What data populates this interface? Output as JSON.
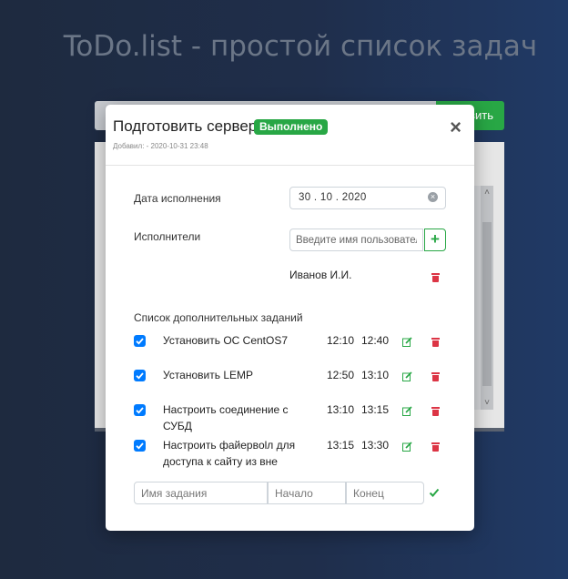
{
  "background": {
    "title": "ToDo.list - простой список задач",
    "add_button": "вить"
  },
  "modal": {
    "title": "Подготовить сервер",
    "status_badge": "Выполнено",
    "added": "Добавил: - 2020-10-31 23:48",
    "close": "×",
    "due_label": "Дата исполнения",
    "due_date": "30 . 10 . 2020",
    "executors_label": "Исполнители",
    "user_placeholder": "Введите имя пользователя",
    "executor": "Иванов И.И.",
    "subtasks_label": "Список дополнительных заданий",
    "subtasks": [
      {
        "name": "Установить ОС CentOS7",
        "start": "12:10",
        "end": "12:40",
        "done": true
      },
      {
        "name": "Установить LEMP",
        "start": "12:50",
        "end": "13:10",
        "done": true
      },
      {
        "name": "Настроить соединение с СУБД",
        "start": "13:10",
        "end": "13:15",
        "done": true
      },
      {
        "name": "Настроить файервolл для доступа к сайту из вне",
        "start": "13:15",
        "end": "13:30",
        "done": true
      }
    ],
    "new_task": {
      "name_placeholder": "Имя задания",
      "start_placeholder": "Начало",
      "end_placeholder": "Конец"
    }
  },
  "colors": {
    "success": "#28a745",
    "danger": "#dc3545",
    "primary": "#007bff"
  }
}
